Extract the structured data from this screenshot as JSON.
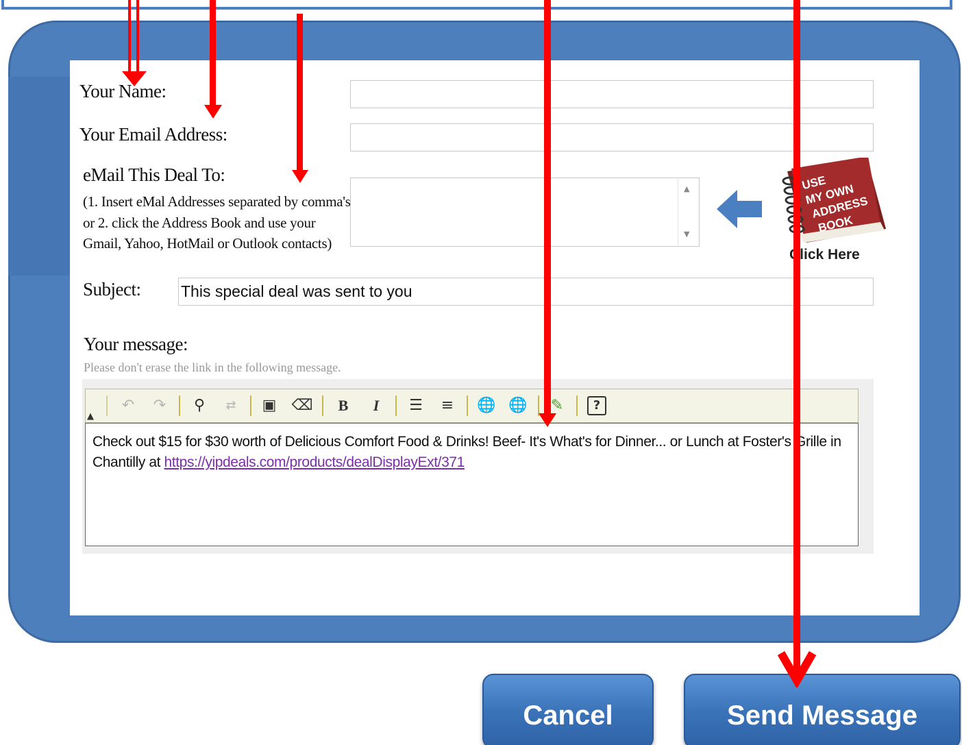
{
  "form": {
    "name_label": "Your Name:",
    "email_label": "Your Email Address:",
    "to_label": "eMail This Deal To:",
    "to_hint": "(1. Insert eMal Addresses separated by comma's or 2. click the Address Book and use your Gmail, Yahoo, HotMail or Outlook contacts)",
    "subject_label": "Subject:",
    "subject_value": "This special deal was sent to you",
    "message_label": "Your message:",
    "message_note": "Please don't erase the link in the following message."
  },
  "address_book": {
    "line1": "USE",
    "line2": "MY OWN",
    "line3": "ADDRESS",
    "line4": "BOOK",
    "click_label": "Click Here"
  },
  "editor": {
    "body_text": "Check out $15 for $30 worth of Delicious Comfort Food & Drinks! Beef- It's What's for Dinner... or Lunch at Foster's Grille in Chantilly at",
    "link_text": "https://yipdeals.com/products/dealDisplayExt/371",
    "bold_glyph": "B",
    "italic_glyph": "I",
    "help_glyph": "?"
  },
  "buttons": {
    "cancel": "Cancel",
    "send": "Send Message"
  },
  "colors": {
    "panel": "#4d7fbd",
    "button": "#3b73b8",
    "annotation": "#ff0000",
    "link": "#7b2ea6"
  }
}
